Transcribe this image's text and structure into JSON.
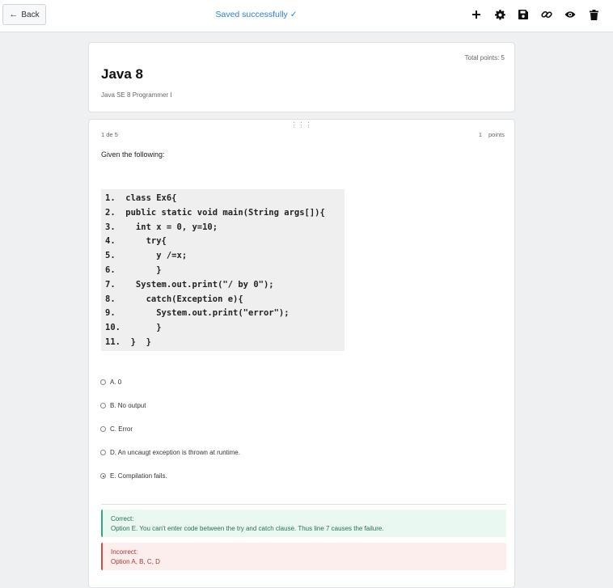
{
  "header": {
    "back_label": "Back",
    "save_status": "Saved successfully ✓",
    "toolbar_icons": [
      "plus-icon",
      "gear-icon",
      "save-icon",
      "link-icon",
      "eye-icon",
      "trash-icon"
    ]
  },
  "quiz": {
    "total_points": "Total points: 5",
    "title": "Java 8",
    "subtitle": "Java SE 8 Programmer I"
  },
  "question": {
    "counter": "1 de 5",
    "points_value": "1",
    "points_label": "points",
    "prompt": "Given the following:",
    "code_lines": [
      "1.  class Ex6{",
      "2.  public static void main(String args[]){",
      "3.    int x = 0, y=10;",
      "4.      try{",
      "5.        y /=x;",
      "6.        }",
      "7.    System.out.print(\"/ by 0\");",
      "8.      catch(Exception e){",
      "9.        System.out.print(\"error\");",
      "10.       }",
      "11.  }  }"
    ],
    "options": [
      {
        "label": "A. 0",
        "selected": false
      },
      {
        "label": "B. No output",
        "selected": false
      },
      {
        "label": "C. Error",
        "selected": false
      },
      {
        "label": "D. An uncaugt exception is thrown at runtime.",
        "selected": false
      },
      {
        "label": "E. Compilation fails.",
        "selected": true
      }
    ]
  },
  "feedback": {
    "correct_title": "Correct:",
    "correct_text": "Option E. You can't enter code between the try and catch clause. Thus line 7 causes the failure.",
    "incorrect_title": "Incorrect:",
    "incorrect_text": "Option A, B, C, D"
  },
  "colors": {
    "accent": "#2f7fd8",
    "correct": "#2eaa7c",
    "incorrect": "#d04848"
  }
}
